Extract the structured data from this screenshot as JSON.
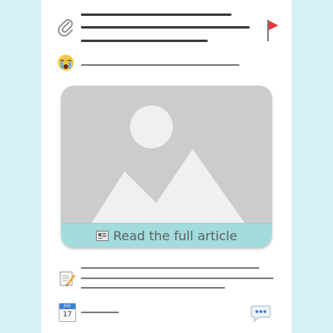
{
  "article_card": {
    "cta_label": "Read the full article",
    "cta_icon": "newspaper-icon"
  },
  "calendar": {
    "month": "July",
    "day": "17"
  },
  "icons": {
    "attachment": "paperclip-icon",
    "flag": "red-flag-icon",
    "reaction": "crying-face-icon",
    "note": "memo-pencil-icon",
    "comment": "speech-bubble-icon"
  },
  "colors": {
    "page_background": "#d3f1f6",
    "card_background": "#ffffff",
    "cta_background": "#a2dcdc",
    "placeholder": "#cccccc",
    "flag": "#e53935"
  }
}
